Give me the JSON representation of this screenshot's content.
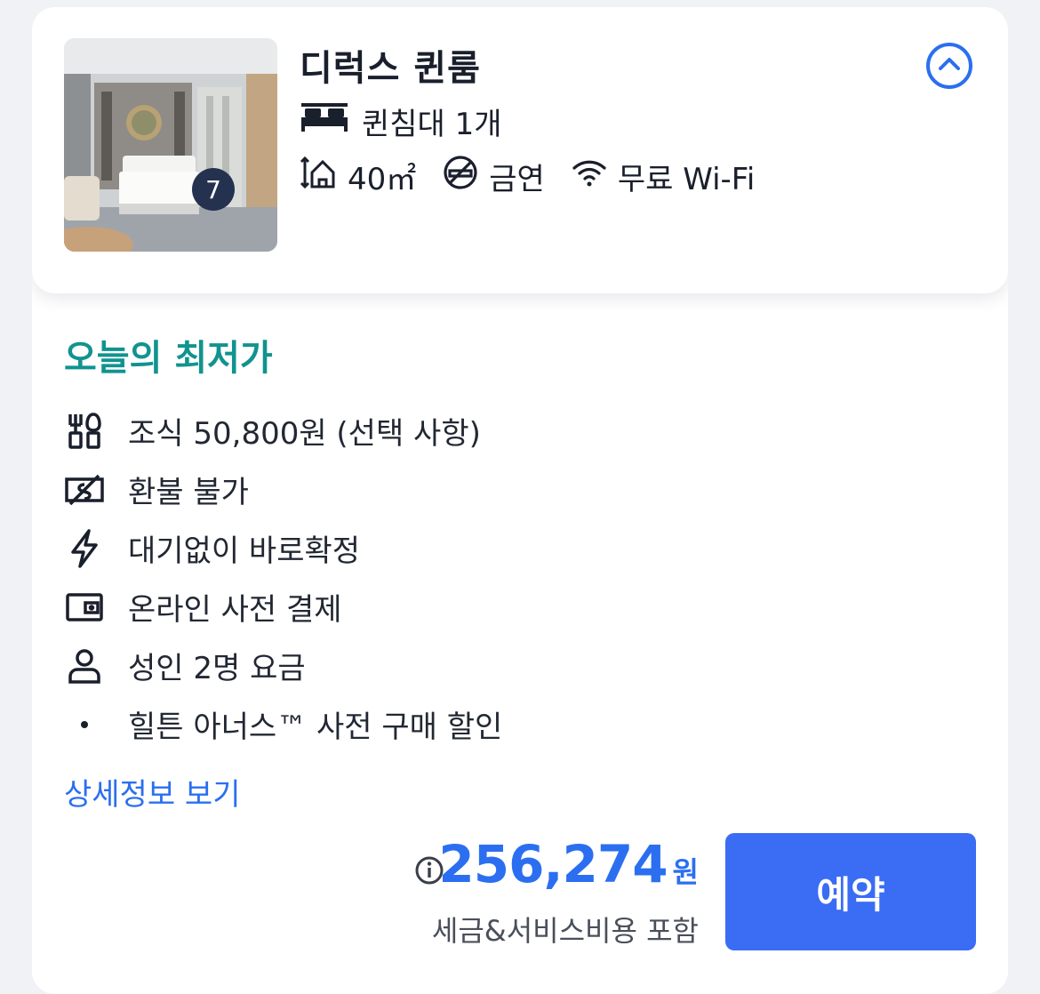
{
  "room": {
    "title": "디럭스 퀸룸",
    "photo_count": "7",
    "bed": "퀸침대 1개",
    "features": [
      {
        "icon": "room-size-icon",
        "label": "40㎡"
      },
      {
        "icon": "no-smoking-icon",
        "label": "금연"
      },
      {
        "icon": "wifi-icon",
        "label": "무료 Wi-Fi"
      }
    ]
  },
  "offer": {
    "section_title": "오늘의 최저가",
    "benefits": [
      {
        "icon": "breakfast-icon",
        "label": "조식 50,800원 (선택 사항)"
      },
      {
        "icon": "non-refundable-icon",
        "label": "환불 불가"
      },
      {
        "icon": "instant-confirm-icon",
        "label": "대기없이 바로확정"
      },
      {
        "icon": "wallet-icon",
        "label": "온라인 사전 결제"
      },
      {
        "icon": "person-icon",
        "label": "성인 2명 요금"
      },
      {
        "icon": "bullet-icon",
        "label": "힐튼 아너스™ 사전 구매 할인"
      }
    ],
    "detail_link": "상세정보 보기",
    "price_amount": "256,274",
    "price_unit": "원",
    "price_note": "세금&서비스비용 포함",
    "book_label": "예약"
  },
  "colors": {
    "accent": "#2b6ff0",
    "teal": "#11938f",
    "button": "#3a6cf4"
  }
}
